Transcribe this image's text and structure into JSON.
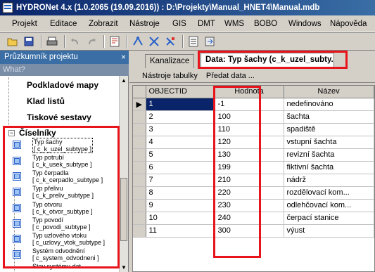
{
  "window": {
    "title": "HYDRONet 4.x (1.0.2065 (19.09.2016)) : D:\\Projekty\\Manual_HNET4\\Manual.mdb"
  },
  "menu": [
    "Projekt",
    "Editace",
    "Zobrazit",
    "Nástroje",
    "GIS",
    "DMT",
    "WMS",
    "BOBO",
    "Windows",
    "Nápověda"
  ],
  "toolbar": {
    "icons": [
      "open-icon",
      "save-icon",
      "print-icon",
      "undo-icon",
      "redo-icon",
      "calc-icon",
      "node-tool-icon",
      "network-tool-icon",
      "check-tool-icon",
      "report-icon",
      "export-icon"
    ]
  },
  "explorer": {
    "title": "Průzkumník projektu",
    "close": "×",
    "search_placeholder": "What?",
    "nodes": [
      "Podkladové mapy",
      "Klad listů",
      "Tiskové sestavy"
    ],
    "expanded": {
      "label": "Číselníky",
      "toggle": "−"
    },
    "leaves": [
      {
        "name": "Typ šachy",
        "code": "[ c_k_uzel_subtype ]"
      },
      {
        "name": "Typ potrubí",
        "code": "[ c_k_usek_subtype ]"
      },
      {
        "name": "Typ čerpadla",
        "code": "[ c_k_cerpadlo_subtype ]"
      },
      {
        "name": "Typ přelivu",
        "code": "[ c_k_preliv_subtype ]"
      },
      {
        "name": "Typ otvoru",
        "code": "[ c_k_otvor_subtype ]"
      },
      {
        "name": "Typ povodí",
        "code": "[ c_povodi_subtype ]"
      },
      {
        "name": "Typ uzlového vtoku",
        "code": "[ c_uzlovy_vtok_subtype ]"
      },
      {
        "name": "Systém odvodnění",
        "code": "[ c_system_odvodneni ]"
      },
      {
        "name": "Stav systému dat",
        "code": ""
      }
    ]
  },
  "tabs": {
    "inactive": "Kanalizace",
    "active": "Data: Typ šachy (c_k_uzel_subty..."
  },
  "subtoolbar": {
    "tools": "Nástroje tabulky",
    "pass": "Předat data ..."
  },
  "table": {
    "columns": [
      "OBJECTID",
      "Hodnota",
      "Název"
    ],
    "current_row_marker": "▶",
    "rows": [
      [
        "1",
        "-1",
        "nedefinováno"
      ],
      [
        "2",
        "100",
        "šachta"
      ],
      [
        "3",
        "110",
        "spadiště"
      ],
      [
        "4",
        "120",
        "vstupní šachta"
      ],
      [
        "5",
        "130",
        "revizní šachta"
      ],
      [
        "6",
        "199",
        "fiktivní šachta"
      ],
      [
        "7",
        "210",
        "nádrž"
      ],
      [
        "8",
        "220",
        "rozdělovací kom..."
      ],
      [
        "9",
        "230",
        "odlehčovací kom..."
      ],
      [
        "10",
        "240",
        "čerpací stanice"
      ],
      [
        "11",
        "300",
        "výust"
      ]
    ]
  },
  "colors": {
    "highlight": "#e8141b",
    "title_bar": "#0a246a"
  }
}
